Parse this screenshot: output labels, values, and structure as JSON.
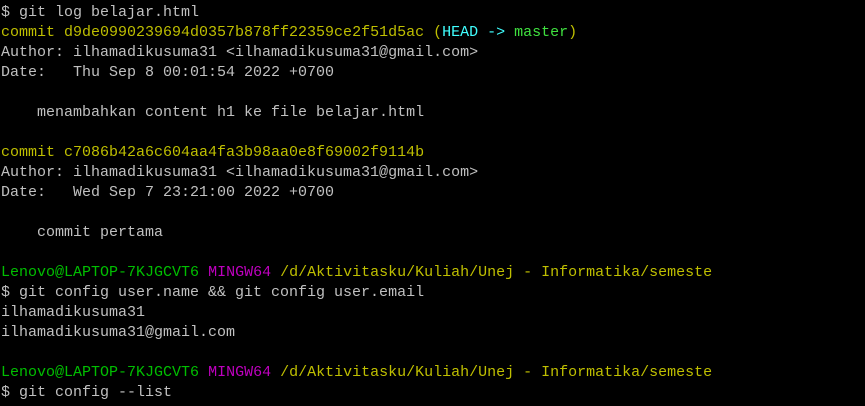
{
  "terminal": {
    "lines": [
      {
        "type": "cmd",
        "text": "$ git log belajar.html"
      },
      {
        "type": "commit",
        "prefix": "commit ",
        "hash": "d9de0990239694d0357b878ff22359ce2f51d5ac",
        "ref_open": " (",
        "head": "HEAD -> ",
        "branch": "master",
        "ref_close": ")"
      },
      {
        "type": "out",
        "text": "Author: ilhamadikusuma31 <ilhamadikusuma31@gmail.com>"
      },
      {
        "type": "out",
        "text": "Date:   Thu Sep 8 00:01:54 2022 +0700"
      },
      {
        "type": "out",
        "text": ""
      },
      {
        "type": "out",
        "text": "    menambahkan content h1 ke file belajar.html"
      },
      {
        "type": "out",
        "text": ""
      },
      {
        "type": "commit2",
        "text": "commit c7086b42a6c604aa4fa3b98aa0e8f69002f9114b"
      },
      {
        "type": "out",
        "text": "Author: ilhamadikusuma31 <ilhamadikusuma31@gmail.com>"
      },
      {
        "type": "out",
        "text": "Date:   Wed Sep 7 23:21:00 2022 +0700"
      },
      {
        "type": "out",
        "text": ""
      },
      {
        "type": "out",
        "text": "    commit pertama"
      },
      {
        "type": "out",
        "text": ""
      },
      {
        "type": "prompt",
        "user": "Lenovo@LAPTOP-7KJGCVT6",
        "shell": "MINGW64",
        "path": "/d/Aktivitasku/Kuliah/Unej - Informatika/semeste"
      },
      {
        "type": "cmd",
        "text": "$ git config user.name && git config user.email"
      },
      {
        "type": "out",
        "text": "ilhamadikusuma31"
      },
      {
        "type": "out",
        "text": "ilhamadikusuma31@gmail.com"
      },
      {
        "type": "out",
        "text": ""
      },
      {
        "type": "prompt",
        "user": "Lenovo@LAPTOP-7KJGCVT6",
        "shell": "MINGW64",
        "path": "/d/Aktivitasku/Kuliah/Unej - Informatika/semeste"
      },
      {
        "type": "cmd",
        "text": "$ git config --list"
      }
    ]
  }
}
